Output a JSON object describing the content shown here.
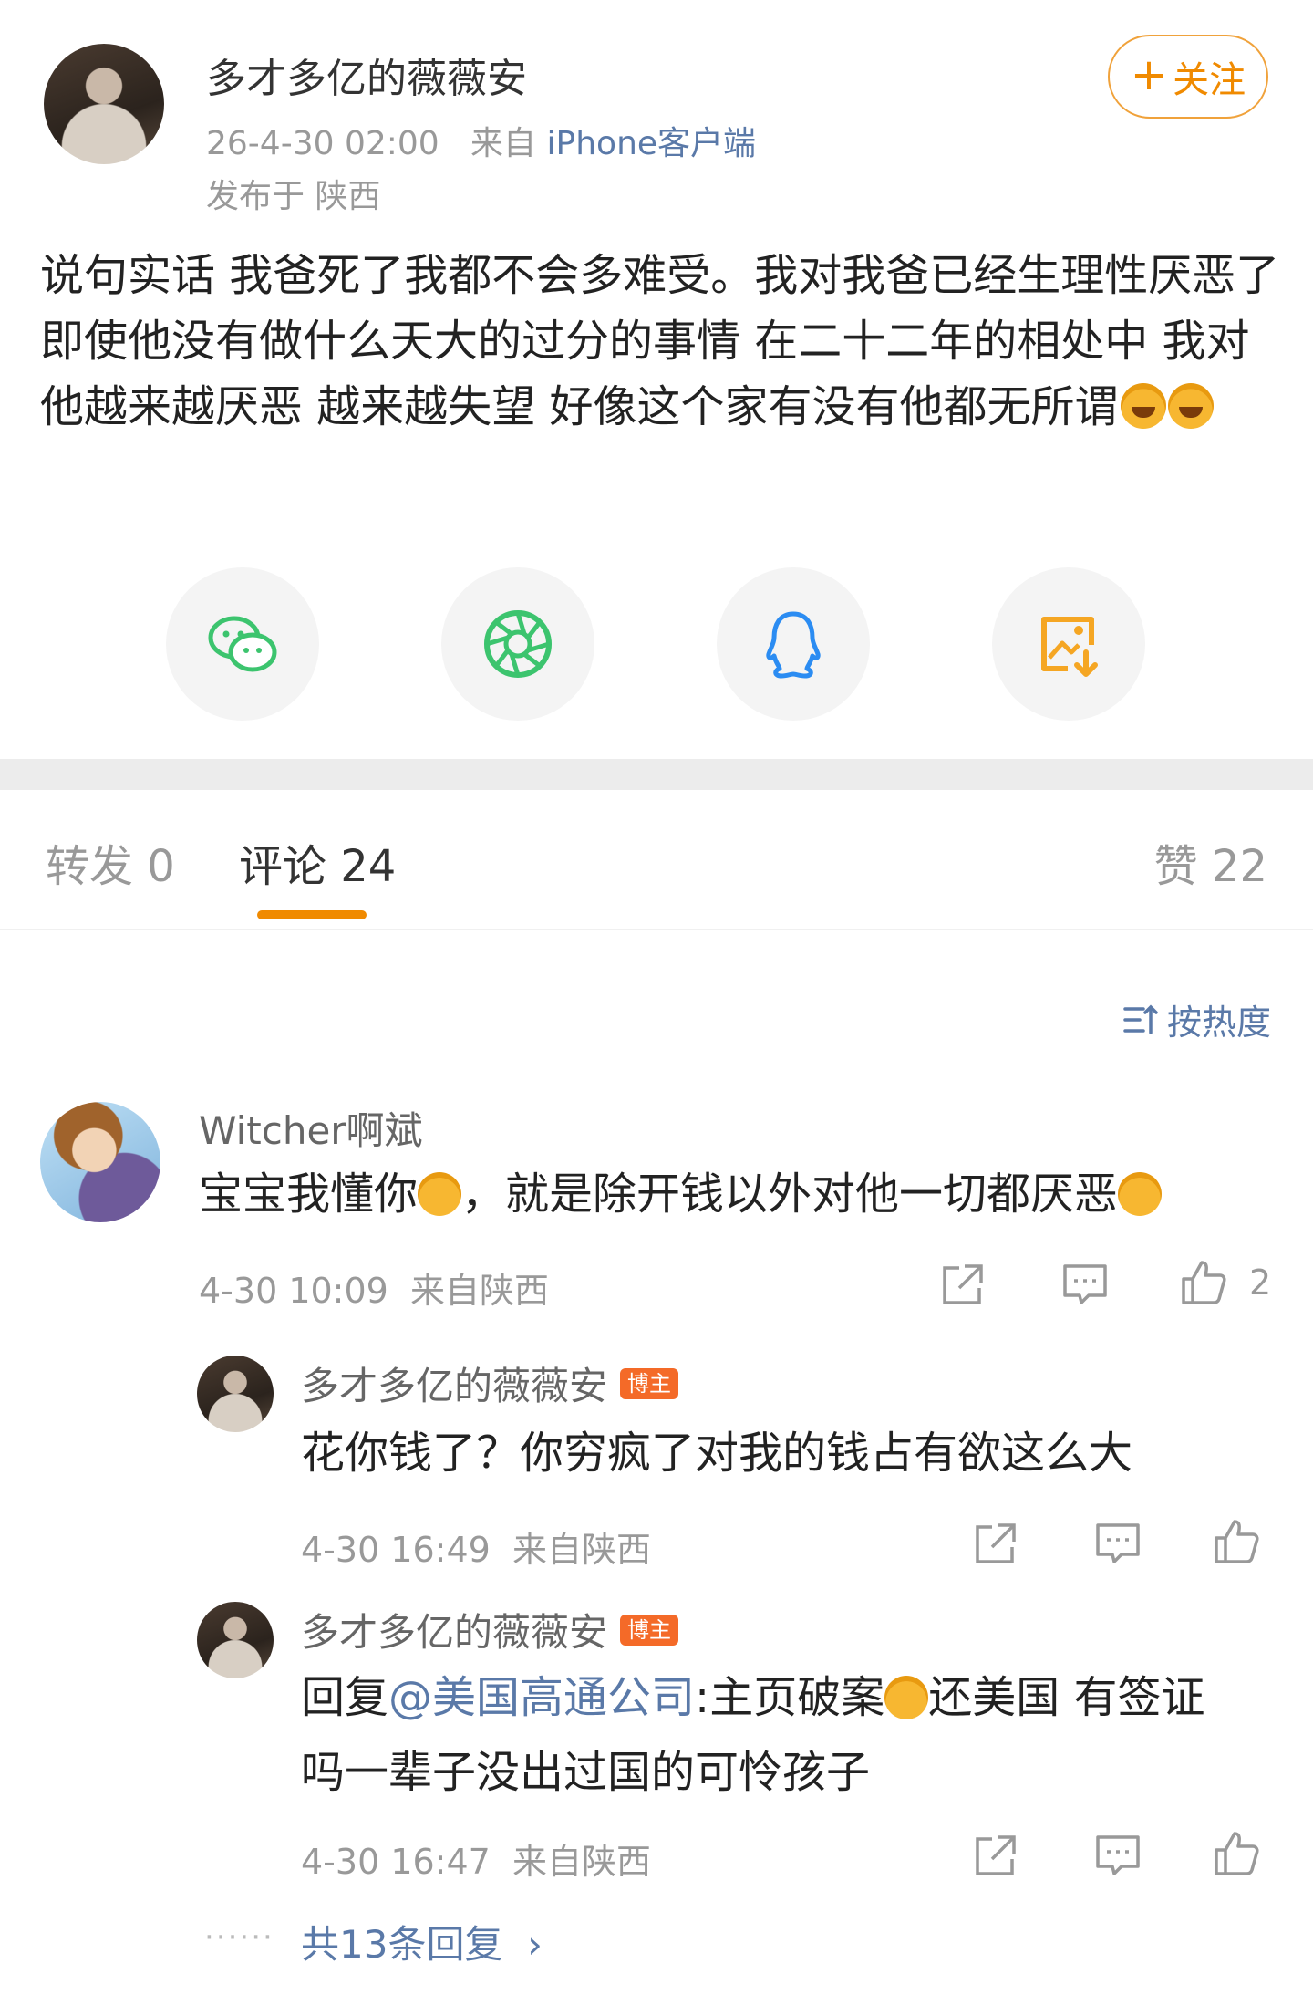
{
  "post": {
    "author": "多才多亿的薇薇安",
    "time": "26-4-30 02:00",
    "source_prefix": "来自",
    "device": "iPhone客户端",
    "location": "发布于 陕西",
    "follow_label": "关注",
    "follow_icon": "plus-icon",
    "text": "说句实话 我爸死了我都不会多难受。我对我爸已经生理性厌恶了 即使他没有做什么天大的过分的事情 在二十二年的相处中 我对他越来越厌恶 越来越失望 好像这个家有没有他都无所谓",
    "emojis": [
      "laugh-cry-emoji",
      "laugh-cry-emoji"
    ]
  },
  "share": {
    "items": [
      {
        "icon": "wechat-icon",
        "color": "#3cc46e"
      },
      {
        "icon": "moments-icon",
        "color": "#3cc46e"
      },
      {
        "icon": "qq-icon",
        "color": "#2b8cf2"
      },
      {
        "icon": "save-image-icon",
        "color": "#f5a623"
      }
    ]
  },
  "tabs": {
    "repost": "转发 0",
    "comment": "评论 24",
    "like": "赞 22",
    "sort": "按热度",
    "accent": "#f08a00"
  },
  "comments": [
    {
      "name": "Witcher啊斌",
      "text_a": "宝宝我懂你",
      "text_b": "，就是除开钱以外对他一切都厌恶",
      "time": "4-30 10:09",
      "location": "来自陕西",
      "likes": "2"
    }
  ],
  "replies": [
    {
      "name": "多才多亿的薇薇安",
      "badge": "博主",
      "text": "花你钱了？你穷疯了对我的钱占有欲这么大",
      "time": "4-30 16:49",
      "location": "来自陕西"
    },
    {
      "name": "多才多亿的薇薇安",
      "badge": "博主",
      "prefix": "回复",
      "mention": "@美国高通公司",
      "text_a": ":主页破案",
      "text_b": "还美国 有签证",
      "text_c": "吗一辈子没出过国的可怜孩子",
      "time": "4-30 16:47",
      "location": "来自陕西"
    }
  ],
  "more_replies": "共13条回复",
  "more_dots": "······"
}
